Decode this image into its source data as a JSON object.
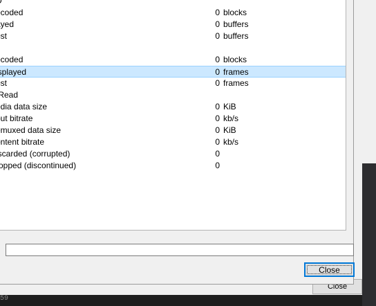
{
  "rows": [
    {
      "label": "D",
      "value": "",
      "unit": ""
    },
    {
      "label": "ecoded",
      "value": "0",
      "unit": "blocks"
    },
    {
      "label": "ayed",
      "value": "0",
      "unit": "buffers"
    },
    {
      "label": "ost",
      "value": "0",
      "unit": "buffers"
    },
    {
      "label": "",
      "value": "",
      "unit": ""
    },
    {
      "label": "ecoded",
      "value": "0",
      "unit": "blocks"
    },
    {
      "label": "isplayed",
      "value": "0",
      "unit": "frames"
    },
    {
      "label": "ost",
      "value": "0",
      "unit": "frames"
    },
    {
      "label": "/Read",
      "value": "",
      "unit": ""
    },
    {
      "label": "edia data size",
      "value": "0",
      "unit": "KiB"
    },
    {
      "label": "put bitrate",
      "value": "0",
      "unit": "kb/s"
    },
    {
      "label": "emuxed data size",
      "value": "0",
      "unit": "KiB"
    },
    {
      "label": "ontent bitrate",
      "value": "0",
      "unit": "kb/s"
    },
    {
      "label": "iscarded (corrupted)",
      "value": "0",
      "unit": ""
    },
    {
      "label": "ropped (discontinued)",
      "value": "0",
      "unit": ""
    }
  ],
  "status_value": "",
  "close_label": "Close",
  "background_close_label": "Close",
  "background_bottom_text": "59"
}
